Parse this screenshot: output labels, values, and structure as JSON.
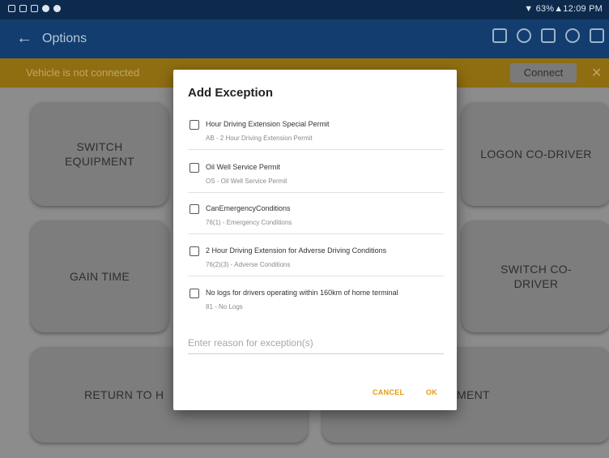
{
  "status_bar": {
    "right_text": "▼ 63%▲12:09 PM"
  },
  "app_bar": {
    "back_icon": "arrow-left-icon",
    "title": "Options"
  },
  "notification": {
    "text": "Vehicle is not connected",
    "connect_label": "Connect",
    "close_icon": "close-icon"
  },
  "tiles": {
    "switch_equipment": "SWITCH EQUIPMENT",
    "logon_codriver": "LOGON CO-DRIVER",
    "gain_time": "GAIN TIME",
    "switch_codriver": "SWITCH CO-DRIVER",
    "return_to": "RETURN TO H",
    "equipment": "MENT"
  },
  "dialog": {
    "title": "Add Exception",
    "options": [
      {
        "label": "Hour Driving Extension Special Permit",
        "sub": "AB - 2 Hour Driving Extension Permit"
      },
      {
        "label": "Oil Well Service Permit",
        "sub": "OS - Oil Well Service Permit"
      },
      {
        "label": "CanEmergencyConditions",
        "sub": "76(1) - Emergency Conditions"
      },
      {
        "label": "2 Hour Driving Extension for Adverse Driving Conditions",
        "sub": "76(2)(3) - Adverse Conditions"
      },
      {
        "label": "No logs for drivers operating within 160km of home terminal",
        "sub": "81 - No Logs"
      }
    ],
    "reason_placeholder": "Enter reason for exception(s)",
    "cancel_label": "CANCEL",
    "ok_label": "OK"
  }
}
